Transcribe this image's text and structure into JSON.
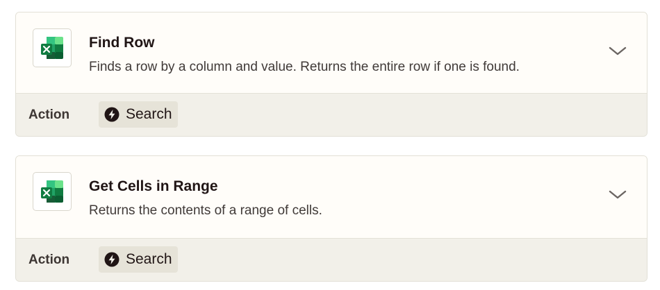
{
  "actions": [
    {
      "title": "Find Row",
      "description": "Finds a row by a column and value. Returns the entire row if one is found.",
      "footer_label": "Action",
      "chip_label": "Search",
      "icon": "excel-icon"
    },
    {
      "title": "Get Cells in Range",
      "description": "Returns the contents of a range of cells.",
      "footer_label": "Action",
      "chip_label": "Search",
      "icon": "excel-icon"
    }
  ],
  "colors": {
    "card_bg": "#fffdf9",
    "footer_bg": "#f2f0e9",
    "chip_bg": "#e6e3d8",
    "title_text": "#201515",
    "excel_green": "#21a366"
  }
}
